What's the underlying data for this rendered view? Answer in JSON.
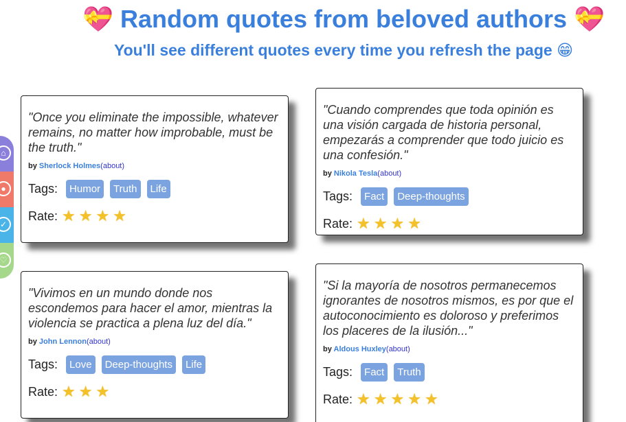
{
  "header": {
    "title": "💝 Random quotes from beloved authors 💝",
    "subtitle": "You'll see different quotes every time you refresh the page 😁"
  },
  "sidebar": {
    "buttons": [
      {
        "icon": "home-icon",
        "color": "#8b7fdc"
      },
      {
        "icon": "github-icon",
        "color": "#f07a6a"
      },
      {
        "icon": "twitter-icon",
        "color": "#4ab3e8"
      },
      {
        "icon": "heart-icon",
        "color": "#a5d88a"
      }
    ]
  },
  "labels": {
    "by": "by",
    "about": "(about)",
    "tags": "Tags:",
    "rate": "Rate:"
  },
  "cards": [
    {
      "quote": "\"Once you eliminate the impossible, whatever remains, no matter how improbable, must be the truth.\"",
      "author": "Sherlock Holmes",
      "tags": [
        "Humor",
        "Truth",
        "Life"
      ],
      "rating": 4
    },
    {
      "quote": "\"Cuando comprendes que toda opinión es una visión cargada de historia personal, empezarás a comprender que todo juicio es una confesión.\"",
      "author": "Nikola Tesla",
      "tags": [
        "Fact",
        "Deep-thoughts"
      ],
      "rating": 4
    },
    {
      "quote": "\"Vivimos en un mundo donde nos escondemos para hacer el amor, mientras la violencia se practica a plena luz del día.\"",
      "author": "John Lennon",
      "tags": [
        "Love",
        "Deep-thoughts",
        "Life"
      ],
      "rating": 3
    },
    {
      "quote": "\"Si la mayoría de nosotros permanecemos ignorantes de nosotros mismos, es por que el autoconocimiento es doloroso y preferimos los placeres de la ilusión...\"",
      "author": "Aldous Huxley",
      "tags": [
        "Fact",
        "Truth"
      ],
      "rating": 5
    }
  ]
}
